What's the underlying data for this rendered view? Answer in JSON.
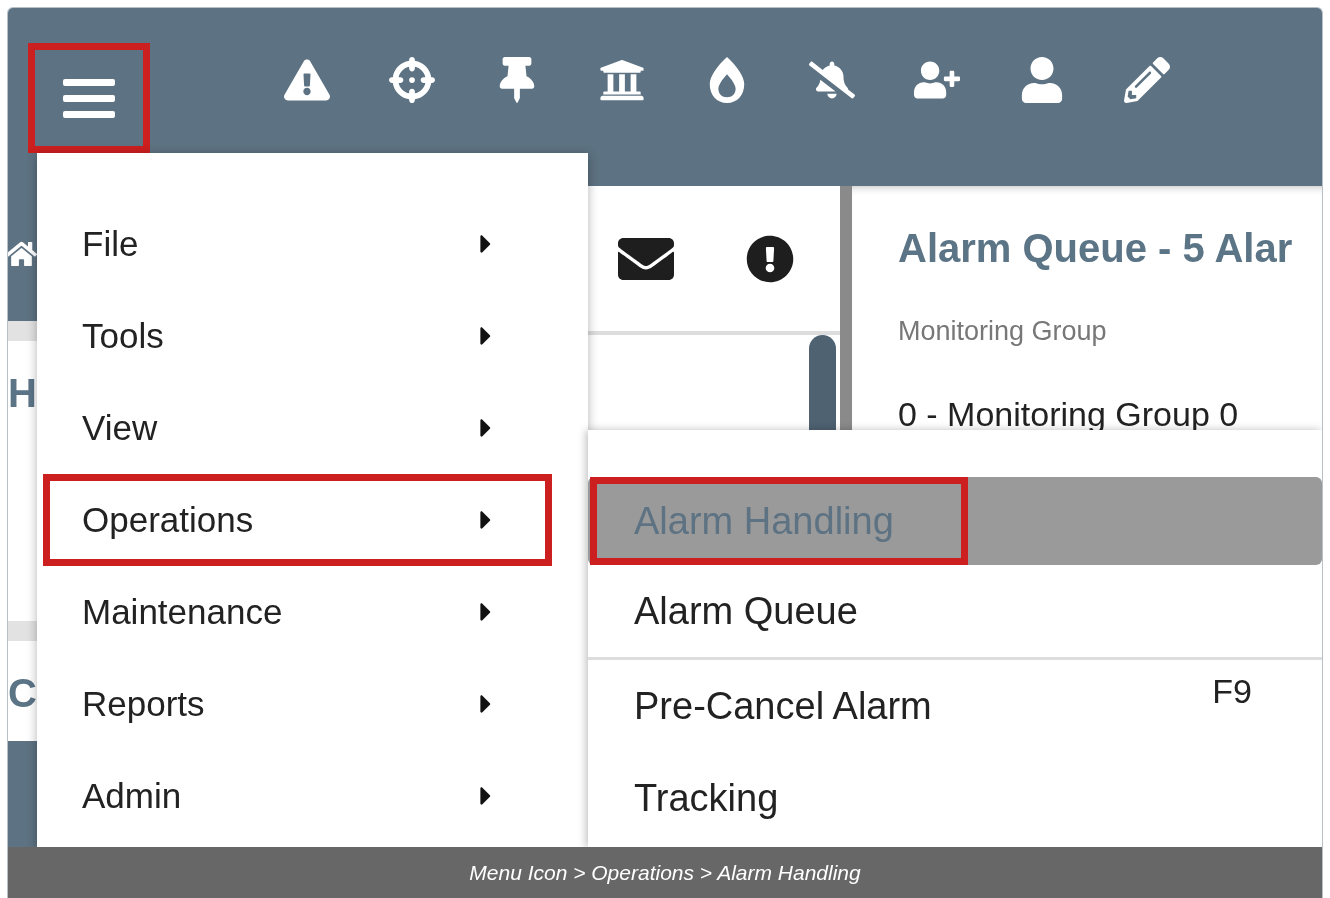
{
  "menu_button": {
    "selected": true
  },
  "side_strip": {
    "texts": [
      "H",
      "C"
    ]
  },
  "right_panel": {
    "title": "Alarm Queue - 5 Alar",
    "field_label": "Monitoring Group",
    "field_value": "0 - Monitoring Group 0"
  },
  "main_menu": {
    "items": [
      {
        "label": "File",
        "selected": false
      },
      {
        "label": "Tools",
        "selected": false
      },
      {
        "label": "View",
        "selected": false
      },
      {
        "label": "Operations",
        "selected": true
      },
      {
        "label": "Maintenance",
        "selected": false
      },
      {
        "label": "Reports",
        "selected": false
      },
      {
        "label": "Admin",
        "selected": false
      }
    ]
  },
  "submenu": {
    "items": [
      {
        "label": "Alarm Handling",
        "selected": true
      },
      {
        "label": "Alarm Queue",
        "selected": false,
        "separator_after": true
      },
      {
        "label": "Pre-Cancel Alarm",
        "selected": false,
        "shortcut": "F9"
      },
      {
        "label": "Tracking",
        "selected": false
      }
    ]
  },
  "caption": "Menu Icon > Operations > Alarm Handling"
}
